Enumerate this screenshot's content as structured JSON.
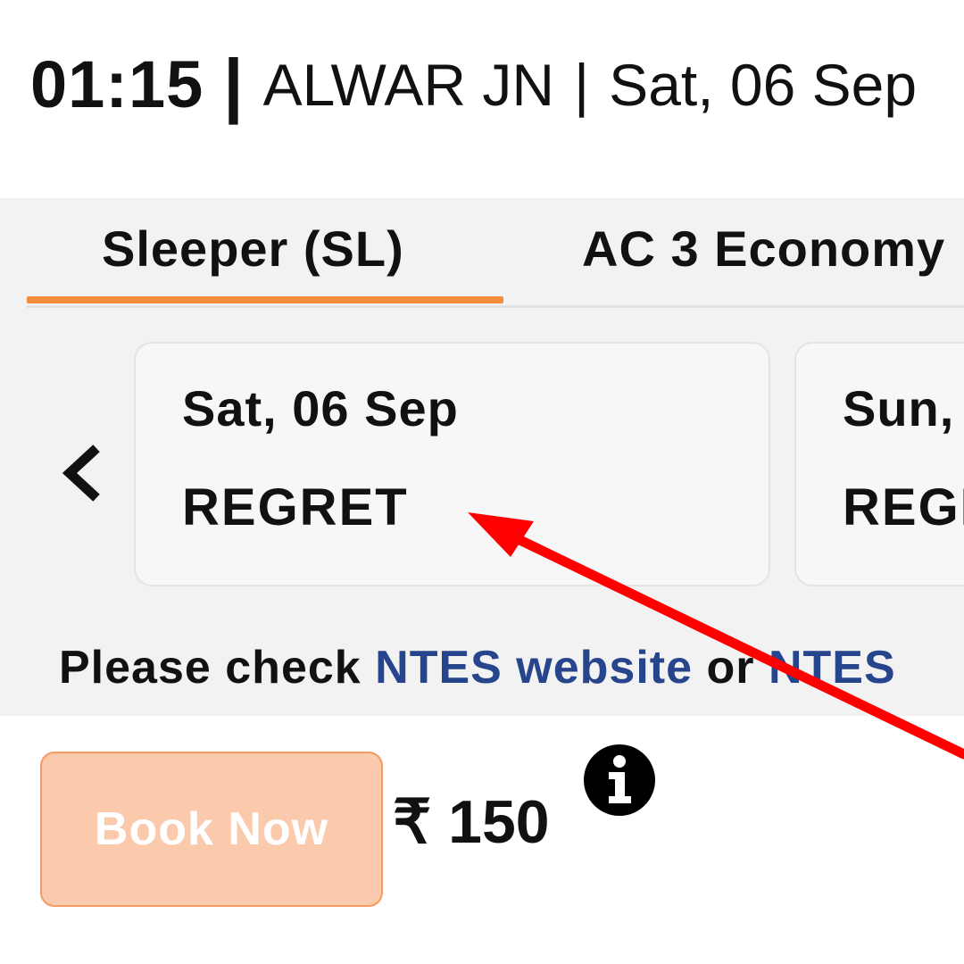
{
  "header": {
    "time": "01:15",
    "separator_bold": "|",
    "station": "ALWAR JN",
    "separator": "|",
    "date": "Sat, 06 Sep"
  },
  "tabs": [
    {
      "label": "Sleeper (SL)",
      "selected": true
    },
    {
      "label": "AC 3 Economy",
      "selected": false
    }
  ],
  "availability": {
    "prev_icon": "chevron-left-icon",
    "cards": [
      {
        "date": "Sat, 06 Sep",
        "status": "REGRET"
      },
      {
        "date": "Sun,",
        "status": "REGRET"
      }
    ]
  },
  "notice": {
    "prefix": "Please check ",
    "link1": "NTES website",
    "middle": " or ",
    "link2": "NTES"
  },
  "booking": {
    "button_label": "Book Now",
    "fare": "₹ 150",
    "info_icon": "info-icon"
  },
  "colors": {
    "accent": "#f58b3a",
    "button_bg": "#fbc9ab",
    "link": "#27458c",
    "annotation_arrow": "#ff0000"
  }
}
